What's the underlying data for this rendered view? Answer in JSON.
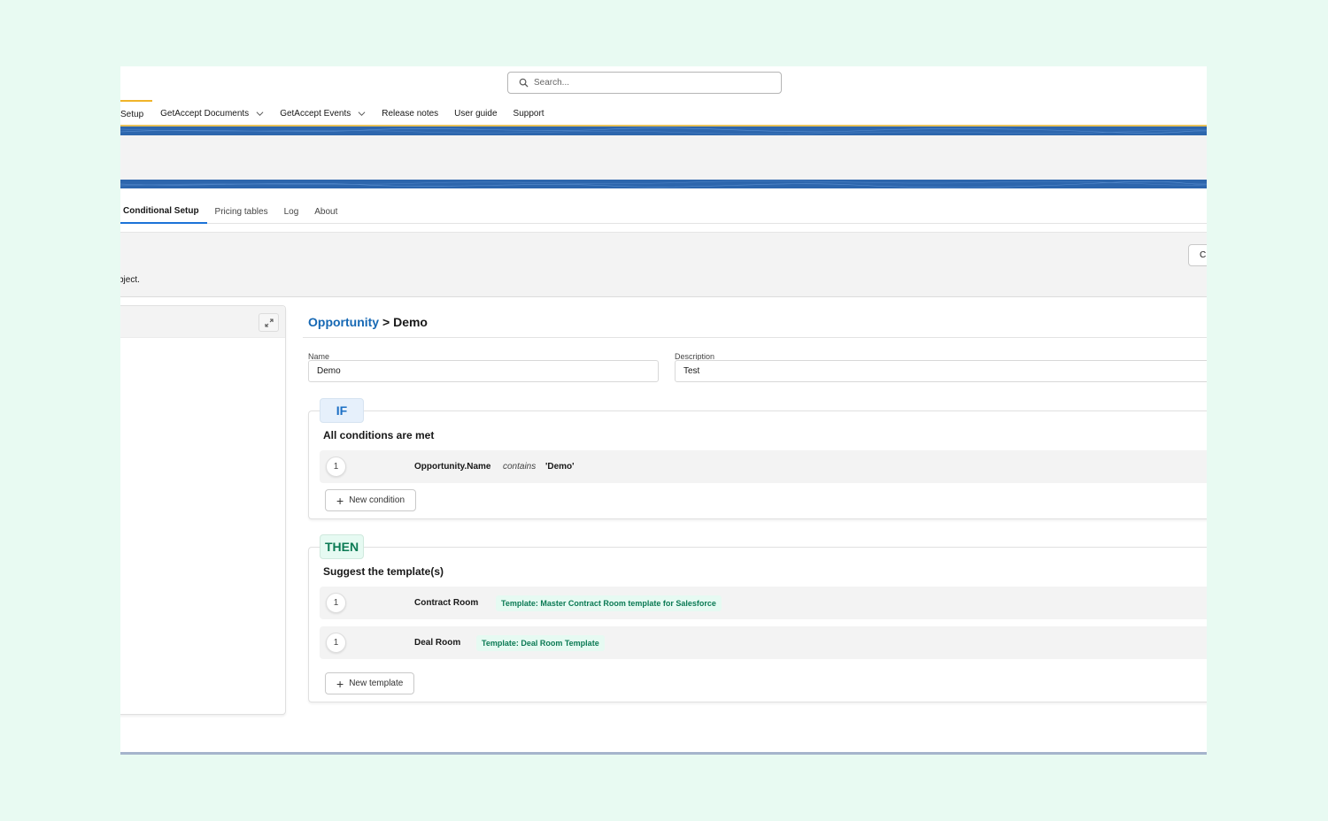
{
  "header": {
    "search_placeholder": "Search...",
    "search_icon": "search-icon"
  },
  "nav": {
    "items": [
      {
        "label": "Setup",
        "active": true,
        "dropdown": false
      },
      {
        "label": "GetAccept Documents",
        "active": false,
        "dropdown": true
      },
      {
        "label": "GetAccept Events",
        "active": false,
        "dropdown": true
      },
      {
        "label": "Release notes",
        "active": false,
        "dropdown": false
      },
      {
        "label": "User guide",
        "active": false,
        "dropdown": false
      },
      {
        "label": "Support",
        "active": false,
        "dropdown": false
      }
    ]
  },
  "tabs": [
    {
      "label": "Conditional Setup",
      "active": true
    },
    {
      "label": "Pricing tables",
      "active": false
    },
    {
      "label": "Log",
      "active": false
    },
    {
      "label": "About",
      "active": false
    }
  ],
  "subheader": {
    "description_fragment": "bject.",
    "button_fragment": "C"
  },
  "left_panel": {
    "expand_icon": "expand-icon"
  },
  "main": {
    "breadcrumb": {
      "object": "Opportunity",
      "separator": " > ",
      "record": "Demo"
    },
    "name_label": "Name",
    "name_value": "Demo",
    "description_label": "Description",
    "description_value": "Test",
    "if_block": {
      "pill": "IF",
      "title": "All conditions are met",
      "conditions": [
        {
          "number": "1",
          "field": "Opportunity.Name",
          "operator": "contains",
          "value": "'Demo'"
        }
      ],
      "add_label": "New condition"
    },
    "then_block": {
      "pill": "THEN",
      "title": "Suggest the template(s)",
      "templates": [
        {
          "number": "1",
          "name": "Contract Room",
          "template": "Template: Master Contract Room template for Salesforce"
        },
        {
          "number": "1",
          "name": "Deal Room",
          "template": "Template: Deal Room Template"
        }
      ],
      "add_label": "New template"
    }
  },
  "colors": {
    "accent_blue": "#1668b4",
    "banner_blue": "#2d66ad",
    "active_nav_gold": "#f0b429",
    "then_green": "#0b7a54",
    "background_mint": "#e8faf2"
  }
}
